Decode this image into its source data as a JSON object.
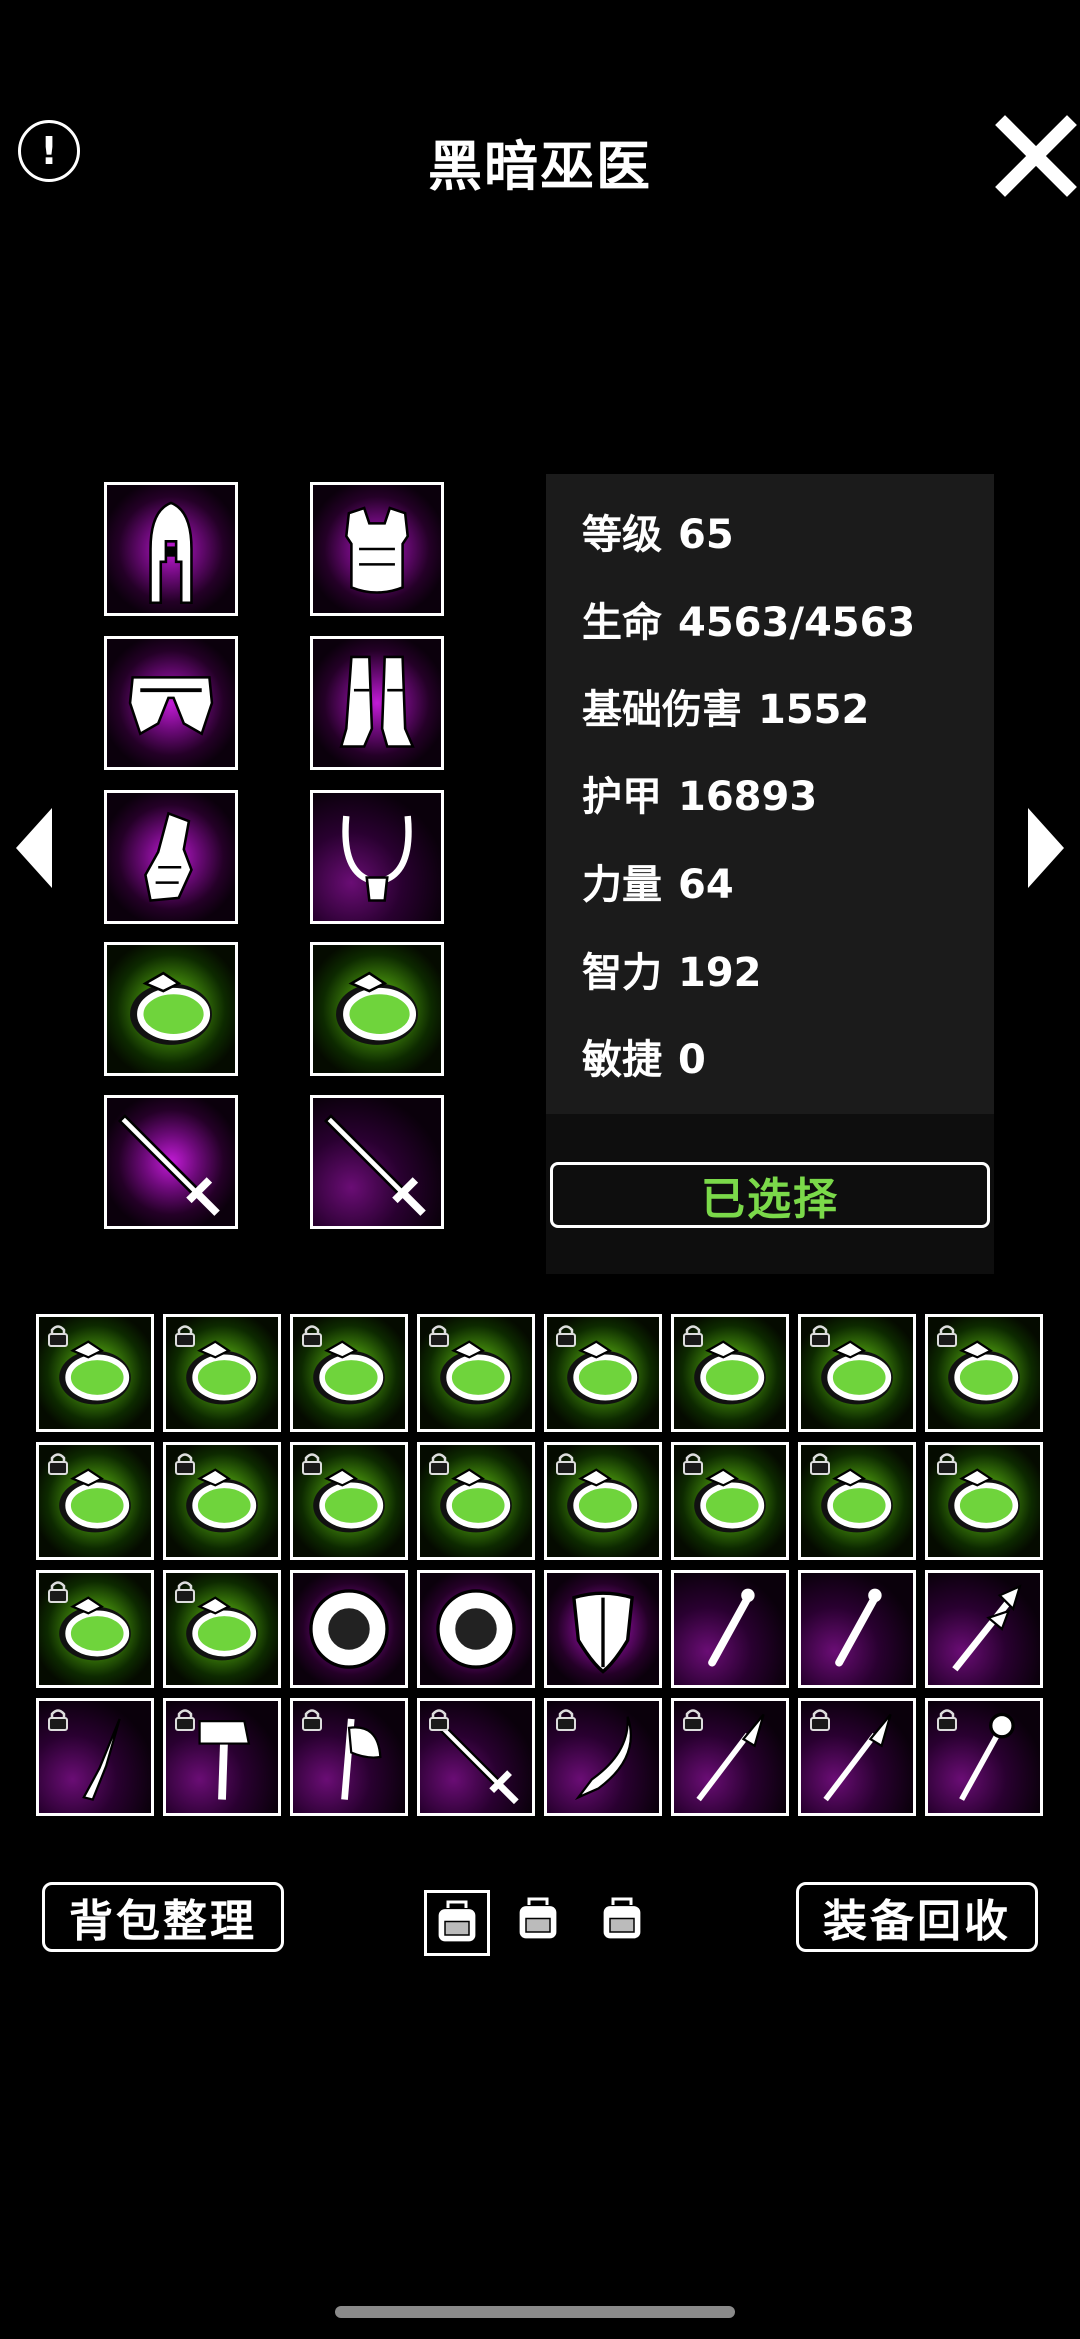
{
  "header": {
    "title": "黑暗巫医",
    "info_icon": "info-icon",
    "close_icon": "close-icon"
  },
  "nav": {
    "prev_icon": "arrow-left-icon",
    "next_icon": "arrow-right-icon"
  },
  "equipment": [
    {
      "slot": "helmet",
      "icon": "helmet-icon",
      "glow": "purple"
    },
    {
      "slot": "chest",
      "icon": "chest-armor-icon",
      "glow": "purple"
    },
    {
      "slot": "pants",
      "icon": "pants-icon",
      "glow": "purple"
    },
    {
      "slot": "boots",
      "icon": "boots-icon",
      "glow": "purple"
    },
    {
      "slot": "gloves",
      "icon": "gloves-icon",
      "glow": "purple"
    },
    {
      "slot": "necklace",
      "icon": "necklace-icon",
      "glow": "dark"
    },
    {
      "slot": "ring-1",
      "icon": "ring-icon",
      "glow": "green"
    },
    {
      "slot": "ring-2",
      "icon": "ring-icon",
      "glow": "green"
    },
    {
      "slot": "weapon-main",
      "icon": "sword-icon",
      "glow": "purple"
    },
    {
      "slot": "weapon-off",
      "icon": "sword-icon",
      "glow": "dark"
    }
  ],
  "stats": [
    {
      "label": "等级",
      "value": "65"
    },
    {
      "label": "生命",
      "value": "4563/4563"
    },
    {
      "label": "基础伤害",
      "value": "1552"
    },
    {
      "label": "护甲",
      "value": "16893"
    },
    {
      "label": "力量",
      "value": "64"
    },
    {
      "label": "智力",
      "value": "192"
    },
    {
      "label": "敏捷",
      "value": "0"
    }
  ],
  "select_button": {
    "label": "已选择"
  },
  "inventory": [
    {
      "icon": "ring-icon",
      "glow": "green",
      "locked": true
    },
    {
      "icon": "ring-icon",
      "glow": "green",
      "locked": true
    },
    {
      "icon": "ring-icon",
      "glow": "green",
      "locked": true
    },
    {
      "icon": "ring-icon",
      "glow": "green",
      "locked": true
    },
    {
      "icon": "ring-icon",
      "glow": "green",
      "locked": true
    },
    {
      "icon": "ring-icon",
      "glow": "green",
      "locked": true
    },
    {
      "icon": "ring-icon",
      "glow": "green",
      "locked": true
    },
    {
      "icon": "ring-icon",
      "glow": "green",
      "locked": true
    },
    {
      "icon": "ring-icon",
      "glow": "green",
      "locked": true
    },
    {
      "icon": "ring-icon",
      "glow": "green",
      "locked": true
    },
    {
      "icon": "ring-icon",
      "glow": "green",
      "locked": true
    },
    {
      "icon": "ring-icon",
      "glow": "green",
      "locked": true
    },
    {
      "icon": "ring-icon",
      "glow": "green",
      "locked": true
    },
    {
      "icon": "ring-icon",
      "glow": "green",
      "locked": true
    },
    {
      "icon": "ring-icon",
      "glow": "green",
      "locked": true
    },
    {
      "icon": "ring-icon",
      "glow": "green",
      "locked": true
    },
    {
      "icon": "ring-icon",
      "glow": "green",
      "locked": true
    },
    {
      "icon": "ring-icon",
      "glow": "green",
      "locked": true
    },
    {
      "icon": "round-shield-icon",
      "glow": "purple",
      "locked": false
    },
    {
      "icon": "round-shield-icon",
      "glow": "purple",
      "locked": false
    },
    {
      "icon": "kite-shield-icon",
      "glow": "purple",
      "locked": false
    },
    {
      "icon": "wand-icon",
      "glow": "dark",
      "locked": false
    },
    {
      "icon": "wand-icon",
      "glow": "dark",
      "locked": false
    },
    {
      "icon": "staff-icon",
      "glow": "dark",
      "locked": false
    },
    {
      "icon": "dagger-icon",
      "glow": "dark",
      "locked": true
    },
    {
      "icon": "hammer-icon",
      "glow": "dark",
      "locked": true
    },
    {
      "icon": "axe-icon",
      "glow": "dark",
      "locked": true
    },
    {
      "icon": "sword-icon",
      "glow": "dark",
      "locked": true
    },
    {
      "icon": "curved-sword-icon",
      "glow": "dark",
      "locked": true
    },
    {
      "icon": "spear-icon",
      "glow": "dark",
      "locked": true
    },
    {
      "icon": "spear-icon",
      "glow": "dark",
      "locked": true
    },
    {
      "icon": "orb-staff-icon",
      "glow": "dark",
      "locked": true
    }
  ],
  "footer": {
    "sort_label": "背包整理",
    "recycle_label": "装备回收",
    "bag_tabs": [
      {
        "icon": "backpack-icon",
        "active": true
      },
      {
        "icon": "backpack-icon",
        "active": false
      },
      {
        "icon": "backpack-icon",
        "active": false
      }
    ]
  },
  "colors": {
    "accent_green": "#7bd94a",
    "glow_purple": "#c21bd6",
    "glow_green": "#73d11c",
    "panel": "#1b1b1b"
  }
}
